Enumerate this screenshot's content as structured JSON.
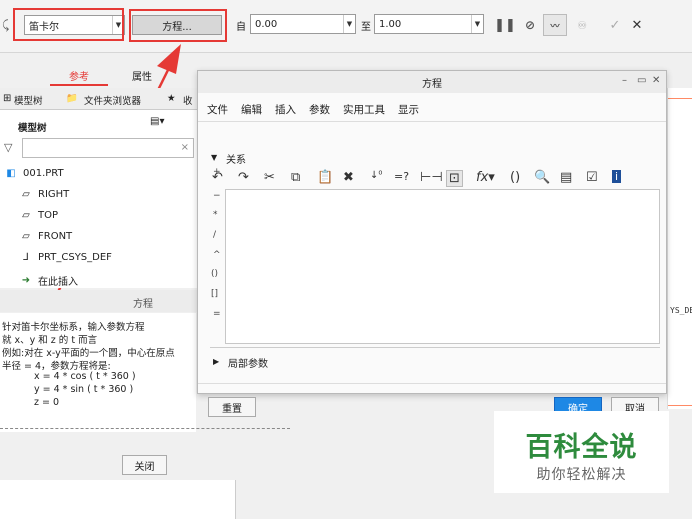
{
  "ribbon": {
    "curve_type": "笛卡尔",
    "equation_button": "方程...",
    "from_label": "自",
    "from_value": "0.00",
    "to_label": "至",
    "to_value": "1.00"
  },
  "tabs": {
    "reference": "参考",
    "properties": "属性"
  },
  "left": {
    "tab_model_tree": "模型树",
    "tab_file_browser": "文件夹浏览器",
    "tab_favorites": "收",
    "heading": "模型树",
    "tree": [
      "001.PRT",
      "RIGHT",
      "TOP",
      "FRONT",
      "PRT_CSYS_DEF",
      "在此插入"
    ]
  },
  "help": {
    "title": "方程",
    "lines": [
      "针对笛卡尔坐标系，输入参数方程",
      "就 x、y 和 z 的 t 而言",
      "例如:对在 x-y平面的一个圆，中心在原点",
      "半径 = 4，参数方程将是:",
      "x = 4 * cos ( t * 360 )",
      "y = 4 * sin ( t * 360 )",
      "z = 0"
    ],
    "close_button": "关闭"
  },
  "dialog": {
    "title": "方程",
    "menu": [
      "文件",
      "编辑",
      "插入",
      "参数",
      "实用工具",
      "显示"
    ],
    "section_relations": "关系",
    "section_local_params": "局部参数",
    "side_symbols": [
      "+",
      "−",
      "*",
      "/",
      "^",
      "()",
      "[]",
      "="
    ],
    "reset_button": "重置",
    "ok_button": "确定",
    "cancel_button": "取消"
  },
  "right_area": {
    "fragment": "YS_DE"
  },
  "watermark": {
    "title": "百科全说",
    "subtitle": "助你轻松解决"
  },
  "colors": {
    "highlight": "#e53935",
    "accent": "#1e88e5",
    "watermark_green": "#2e8b3d"
  }
}
